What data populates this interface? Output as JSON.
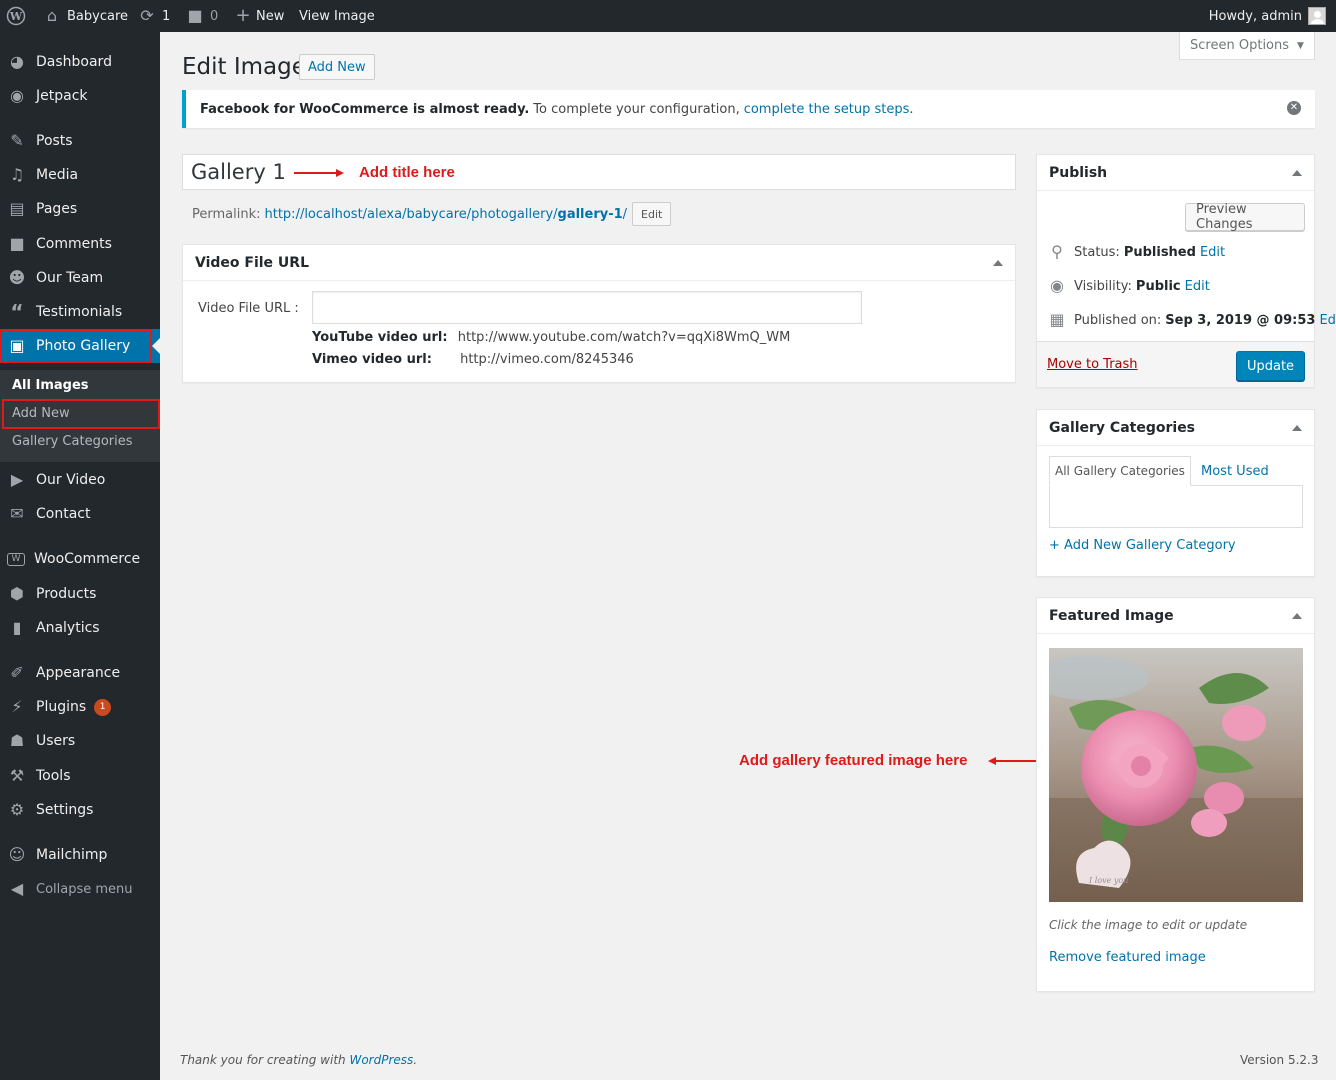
{
  "adminbar": {
    "wp_logo_icon": "wordpress-icon",
    "site_name": "Babycare",
    "updates_count": "1",
    "comments_count": "0",
    "new_label": "New",
    "view_label": "View Image",
    "howdy": "Howdy, admin"
  },
  "sidebar": {
    "items": [
      {
        "label": "Dashboard",
        "icon": "dashboard-icon"
      },
      {
        "label": "Jetpack",
        "icon": "jetpack-icon"
      },
      {
        "label": "Posts",
        "icon": "pin-icon"
      },
      {
        "label": "Media",
        "icon": "media-icon"
      },
      {
        "label": "Pages",
        "icon": "pages-icon"
      },
      {
        "label": "Comments",
        "icon": "comment-icon"
      },
      {
        "label": "Our Team",
        "icon": "team-icon"
      },
      {
        "label": "Testimonials",
        "icon": "quote-icon"
      },
      {
        "label": "Photo Gallery",
        "icon": "gallery-icon"
      },
      {
        "label": "Our Video",
        "icon": "video-icon"
      },
      {
        "label": "Contact",
        "icon": "mail-icon"
      },
      {
        "label": "WooCommerce",
        "icon": "woo-icon"
      },
      {
        "label": "Products",
        "icon": "box-icon"
      },
      {
        "label": "Analytics",
        "icon": "chart-icon"
      },
      {
        "label": "Appearance",
        "icon": "brush-icon"
      },
      {
        "label": "Plugins",
        "icon": "plugin-icon"
      },
      {
        "label": "Users",
        "icon": "user-icon"
      },
      {
        "label": "Tools",
        "icon": "wrench-icon"
      },
      {
        "label": "Settings",
        "icon": "settings-icon"
      },
      {
        "label": "Mailchimp",
        "icon": "mailchimp-icon"
      },
      {
        "label": "Collapse menu",
        "icon": "collapse-icon"
      }
    ],
    "plugins_badge": "1",
    "submenu": [
      "All Images",
      "Add New",
      "Gallery Categories"
    ]
  },
  "header": {
    "title": "Edit Image",
    "add_new": "Add New",
    "screen_options": "Screen Options"
  },
  "notice": {
    "bold": "Facebook for WooCommerce is almost ready.",
    "text": "To complete your configuration,",
    "link": "complete the setup steps",
    "end": "."
  },
  "editor": {
    "title_value": "Gallery 1",
    "permalink_label": "Permalink:",
    "permalink_base": "http://localhost/alexa/babycare/photogallery/",
    "permalink_slug": "gallery-1",
    "permalink_end": "/",
    "permalink_edit": "Edit"
  },
  "annotations": {
    "title": "Add title here",
    "featured": "Add gallery featured image here"
  },
  "video_box": {
    "heading": "Video File URL",
    "field_label": "Video File URL :",
    "field_value": "",
    "youtube_label": "YouTube video url:",
    "youtube_example": "http://www.youtube.com/watch?v=qqXi8WmQ_WM",
    "vimeo_label": "Vimeo video url:",
    "vimeo_example": "http://vimeo.com/8245346"
  },
  "publish": {
    "heading": "Publish",
    "preview": "Preview Changes",
    "status_label": "Status:",
    "status_value": "Published",
    "visibility_label": "Visibility:",
    "visibility_value": "Public",
    "published_label": "Published on:",
    "published_value": "Sep 3, 2019 @ 09:53",
    "edit": "Edit",
    "trash": "Move to Trash",
    "update": "Update"
  },
  "categories": {
    "heading": "Gallery Categories",
    "tab_all": "All Gallery Categories",
    "tab_most": "Most Used",
    "add_new": "+ Add New Gallery Category"
  },
  "featured": {
    "heading": "Featured Image",
    "caption": "Click the image to edit or update",
    "remove": "Remove featured image"
  },
  "footer": {
    "thanks": "Thank you for creating with",
    "link": "WordPress",
    "end": ".",
    "version": "Version 5.2.3"
  },
  "colors": {
    "admin_bg": "#23282d",
    "accent": "#0073aa",
    "annotation": "#e01919",
    "notice_border": "#00a0d2"
  }
}
